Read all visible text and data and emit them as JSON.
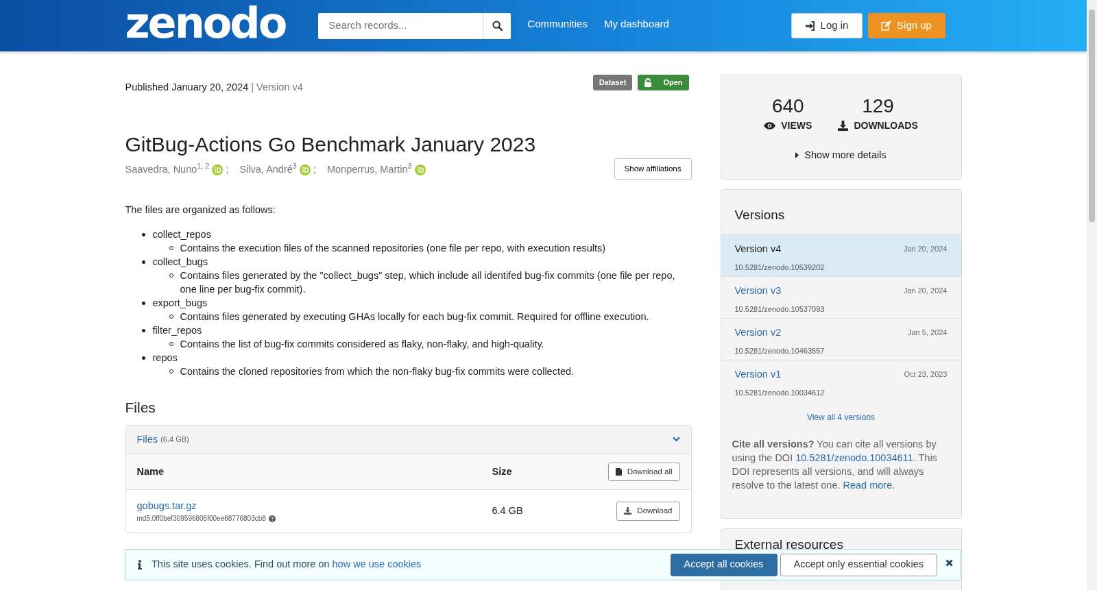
{
  "header": {
    "logo": "zenodo",
    "search": {
      "placeholder": "Search records..."
    },
    "nav_links": [
      "Communities",
      "My dashboard"
    ],
    "buttons": [
      {
        "label": "Log in",
        "kind": "login"
      },
      {
        "label": "Sign up",
        "kind": "signup"
      }
    ]
  },
  "record": {
    "published": "Published January 20, 2024",
    "version": "| Version v4",
    "badges": [
      {
        "label": "Dataset",
        "kind": "type"
      },
      {
        "label": "Open",
        "kind": "access"
      }
    ],
    "title": "GitBug-Actions Go Benchmark January 2023",
    "creators": [
      {
        "name": "Saavedra, Nuno$^{1, 2}$",
        "separator": ";"
      },
      {
        "name": "Silva, André$^{3}$",
        "separator": ";"
      },
      {
        "name": "Monperrus, Martin$^{3}$"
      }
    ],
    "show_affiliations": "Show affiliations",
    "description": {
      "intro": "The files are organized as follows:",
      "items": [
        {
          "text": "collect_repos",
          "children": [
            {
              "text": "Contains the execution files of the scanned repositories (one file per repo, with execution results)"
            }
          ]
        },
        {
          "text": "collect_bugs",
          "children": [
            {
              "text": "Contains files generated by the \"collect_bugs\" step, which include all identifed bug-fix commits (one file per repo, one line per bug-fix commit)."
            }
          ]
        },
        {
          "text": "export_bugs",
          "children": [
            {
              "text": "Contains files generated by executing  GHAs locally for each bug-fix commit. Required for offline execution."
            }
          ]
        },
        {
          "text": "filter_repos",
          "children": [
            {
              "text": "Contains the list of bug-fix commits considered as flaky, non-flaky, and high-quality."
            }
          ]
        },
        {
          "text": "repos",
          "children": [
            {
              "text": "Contains the cloned repositories from which the non-flaky bug-fix commits were collected."
            }
          ]
        }
      ]
    }
  },
  "files": {
    "heading": "Files",
    "panel": {
      "title": "Files",
      "size": "(6.4 GB)",
      "expanded": true
    },
    "columns": [
      "Name",
      "Size"
    ],
    "download_all": "Download all",
    "rows": [
      {
        "name": "gobugs.tar.gz",
        "checksum": "md5:0ff0bef309596805f00ee68776803cb8",
        "size": "6.4 GB",
        "action": "Download"
      }
    ]
  },
  "sidebar": {
    "stats": [
      {
        "value": "640",
        "label": "VIEWS",
        "kind": "views"
      },
      {
        "value": "129",
        "label": "DOWNLOADS",
        "kind": "downloads"
      }
    ],
    "more_details": "Show more details",
    "versions": {
      "heading": "Versions",
      "items": [
        {
          "label": "Version v4",
          "date": "Jan 20, 2024",
          "doi": "10.5281/zenodo.10539202",
          "selected": true
        },
        {
          "label": "Version v3",
          "date": "Jan 20, 2024",
          "doi": "10.5281/zenodo.10537093",
          "selected": false
        },
        {
          "label": "Version v2",
          "date": "Jan 5, 2024",
          "doi": "10.5281/zenodo.10463557",
          "selected": false
        },
        {
          "label": "Version v1",
          "date": "Oct 23, 2023",
          "doi": "10.5281/zenodo.10034612",
          "selected": false
        }
      ],
      "view_all": "View all 4 versions",
      "cite_note": "**Cite all versions?** You can cite all versions by using the DOI ",
      "cite_doi": "10.5281/zenodo.10034611",
      "cite_note_2": ". This DOI represents all versions, and will always resolve to the latest one. ",
      "read_more": "Read more",
      "cite_end": "."
    },
    "external": {
      "heading": "External resources"
    }
  },
  "cookie_banner": {
    "text": "This site uses cookies. Find out more on ",
    "link": "how we use cookies",
    "buttons": [
      {
        "label": "Accept all cookies",
        "kind": "primary"
      },
      {
        "label": "Accept only essential cookies",
        "kind": "secondary"
      }
    ]
  }
}
